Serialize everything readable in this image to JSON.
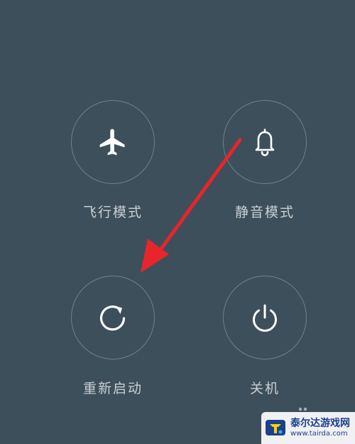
{
  "power_menu": {
    "buttons": [
      {
        "id": "airplane",
        "label": "飞行模式",
        "icon": "airplane-icon"
      },
      {
        "id": "silent",
        "label": "静音模式",
        "icon": "bell-icon"
      },
      {
        "id": "restart",
        "label": "重新启动",
        "icon": "restart-icon"
      },
      {
        "id": "shutdown",
        "label": "关机",
        "icon": "power-icon"
      }
    ]
  },
  "annotation": {
    "arrow_color": "#e8252a",
    "points_to": "restart"
  },
  "watermark": {
    "name": "泰尔达游戏网",
    "url": "www.tairda.com",
    "color": "#1d3f8f"
  },
  "colors": {
    "background": "#3d4f5b",
    "icon": "#ffffff",
    "label": "#c5ccd1"
  }
}
